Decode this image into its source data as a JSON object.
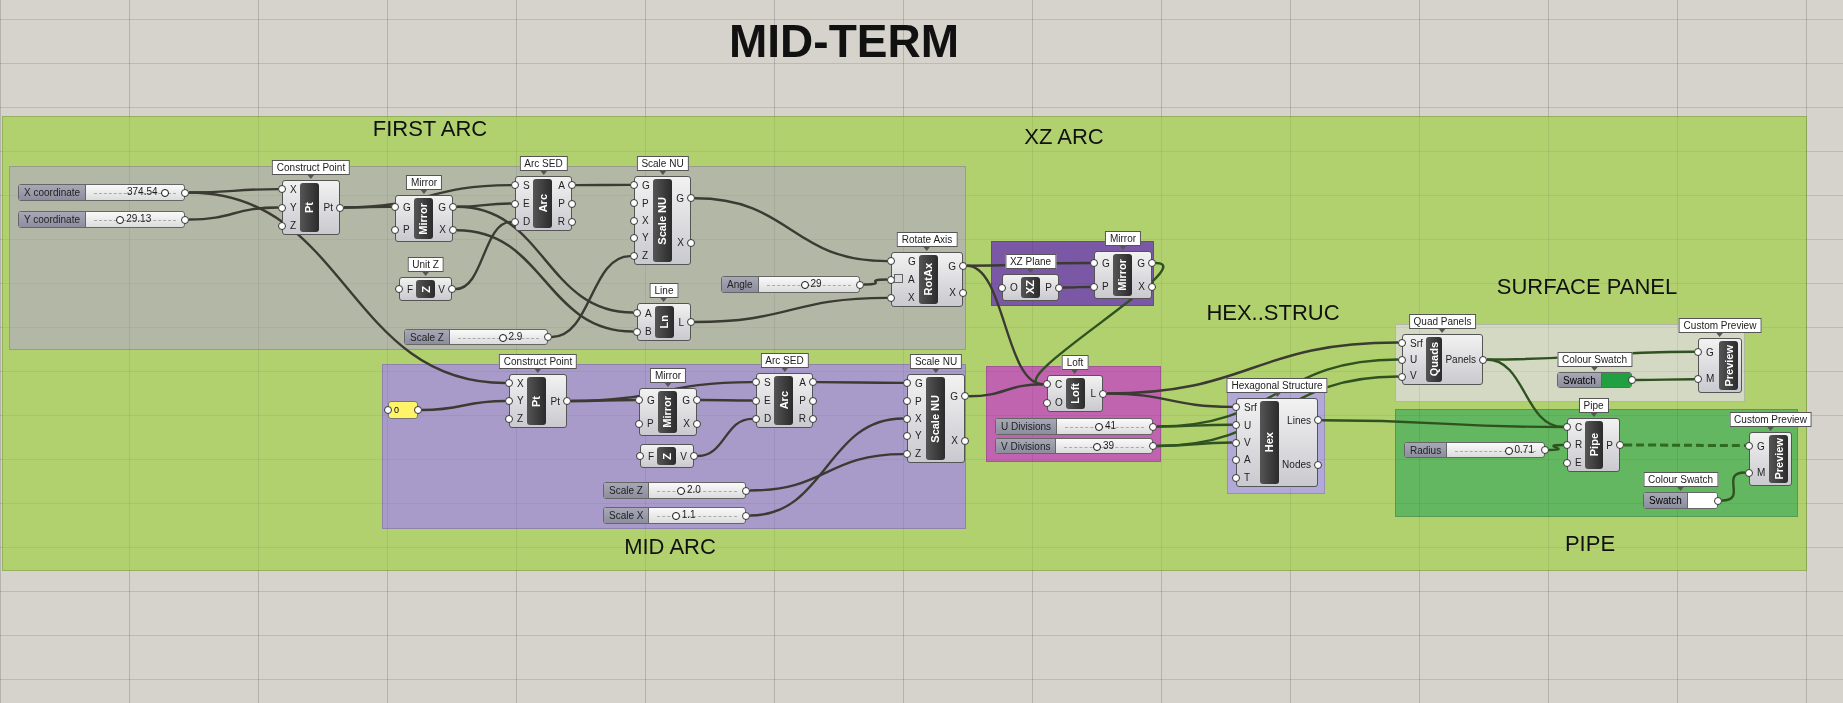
{
  "canvas_title": "MID-TERM",
  "main_group": {
    "color": "#b1d16f",
    "labels": [
      "FIRST ARC",
      "XZ ARC",
      "HEX..STRUC",
      "SURFACE PANEL",
      "MID ARC",
      "PIPE"
    ]
  },
  "sub_groups": [
    {
      "color": "#b3b8a6"
    },
    {
      "color": "#a99bc9"
    },
    {
      "color": "#7b58a6"
    },
    {
      "color": "#c064b0"
    },
    {
      "color": "#b2a9d8"
    },
    {
      "color": "#d3d9c3"
    },
    {
      "color": "#62b760"
    }
  ],
  "components": [
    {
      "kind": "slider",
      "label": "X coordinate",
      "value": "374.54",
      "level": 0.86
    },
    {
      "kind": "slider",
      "label": "Y coordinate",
      "value": "29.13",
      "level": 0.32
    },
    {
      "kind": "component",
      "title": "Construct Point",
      "nickname": "Pt",
      "inputs": [
        "X",
        "Y",
        "Z"
      ],
      "outputs": [
        "Pt"
      ]
    },
    {
      "kind": "component",
      "title": "Mirror",
      "nickname": "Mirror",
      "inputs": [
        "G",
        "P"
      ],
      "outputs": [
        "G",
        "X"
      ]
    },
    {
      "kind": "component",
      "title": "Unit Z",
      "nickname": "Z",
      "inputs": [
        "F"
      ],
      "outputs": [
        "V"
      ]
    },
    {
      "kind": "component",
      "title": "Arc SED",
      "nickname": "Arc",
      "inputs": [
        "S",
        "E",
        "D"
      ],
      "outputs": [
        "A",
        "P",
        "R"
      ]
    },
    {
      "kind": "component",
      "title": "Scale NU",
      "nickname": "Scale NU",
      "inputs": [
        "G",
        "P",
        "X",
        "Y",
        "Z"
      ],
      "outputs": [
        "G",
        "X"
      ]
    },
    {
      "kind": "component",
      "title": "Line",
      "nickname": "Ln",
      "inputs": [
        "A",
        "B"
      ],
      "outputs": [
        "L"
      ]
    },
    {
      "kind": "slider",
      "label": "Angle",
      "value": "29",
      "level": 0.45
    },
    {
      "kind": "component",
      "title": "Rotate Axis",
      "nickname": "RotAx",
      "inputs": [
        "G",
        "A",
        "X"
      ],
      "outputs": [
        "G",
        "X"
      ]
    },
    {
      "kind": "slider",
      "label": "Scale Z",
      "value": "2.9",
      "level": 0.55
    },
    {
      "kind": "component",
      "title": "XZ Plane",
      "nickname": "XZ",
      "inputs": [
        "O"
      ],
      "outputs": [
        "P"
      ]
    },
    {
      "kind": "component",
      "title": "Mirror",
      "nickname": "Mirror",
      "inputs": [
        "G",
        "P"
      ],
      "outputs": [
        "G",
        "X"
      ]
    },
    {
      "kind": "panel",
      "text": "0"
    },
    {
      "kind": "component",
      "title": "Construct Point",
      "nickname": "Pt",
      "inputs": [
        "X",
        "Y",
        "Z"
      ],
      "outputs": [
        "Pt"
      ]
    },
    {
      "kind": "component",
      "title": "Mirror",
      "nickname": "Mirror",
      "inputs": [
        "G",
        "P"
      ],
      "outputs": [
        "G",
        "X"
      ]
    },
    {
      "kind": "component",
      "nickname": "Z",
      "inputs": [
        "F"
      ],
      "outputs": [
        "V"
      ]
    },
    {
      "kind": "component",
      "title": "Arc SED",
      "nickname": "Arc",
      "inputs": [
        "S",
        "E",
        "D"
      ],
      "outputs": [
        "A",
        "P",
        "R"
      ]
    },
    {
      "kind": "component",
      "title": "Scale NU",
      "nickname": "Scale NU",
      "inputs": [
        "G",
        "P",
        "X",
        "Y",
        "Z"
      ],
      "outputs": [
        "G",
        "X"
      ]
    },
    {
      "kind": "slider",
      "label": "Scale Z",
      "value": "2.0",
      "level": 0.3
    },
    {
      "kind": "slider",
      "label": "Scale X",
      "value": "1.1",
      "level": 0.23
    },
    {
      "kind": "component",
      "title": "Loft",
      "nickname": "Loft",
      "inputs": [
        "C",
        "O"
      ],
      "outputs": [
        "L"
      ]
    },
    {
      "kind": "slider",
      "label": "U Divisions",
      "value": "41",
      "level": 0.43
    },
    {
      "kind": "slider",
      "label": "V Divisions",
      "value": "39",
      "level": 0.41
    },
    {
      "kind": "component",
      "title": "Hexagonal Structure",
      "nickname": "Hex",
      "inputs": [
        "Srf",
        "U",
        "V",
        "A",
        "T"
      ],
      "outputs": [
        "Lines",
        "Nodes"
      ]
    },
    {
      "kind": "component",
      "title": "Quad Panels",
      "nickname": "Quads",
      "inputs": [
        "Srf",
        "U",
        "V"
      ],
      "outputs": [
        "Panels"
      ]
    },
    {
      "kind": "swatch",
      "title": "Colour Swatch",
      "label": "Swatch",
      "color": "#20a040"
    },
    {
      "kind": "component",
      "title": "Custom Preview",
      "nickname": "Preview",
      "inputs": [
        "G",
        "M"
      ]
    },
    {
      "kind": "component",
      "title": "Pipe",
      "nickname": "Pipe",
      "inputs": [
        "C",
        "R",
        "E"
      ],
      "outputs": [
        "P"
      ]
    },
    {
      "kind": "slider",
      "label": "Radius",
      "value": "0.71",
      "level": 0.66
    },
    {
      "kind": "component",
      "title": "Custom Preview",
      "nickname": "Preview",
      "inputs": [
        "G",
        "M"
      ]
    },
    {
      "kind": "swatch",
      "title": "Colour Swatch",
      "label": "Swatch",
      "color": "#ffffff"
    }
  ]
}
